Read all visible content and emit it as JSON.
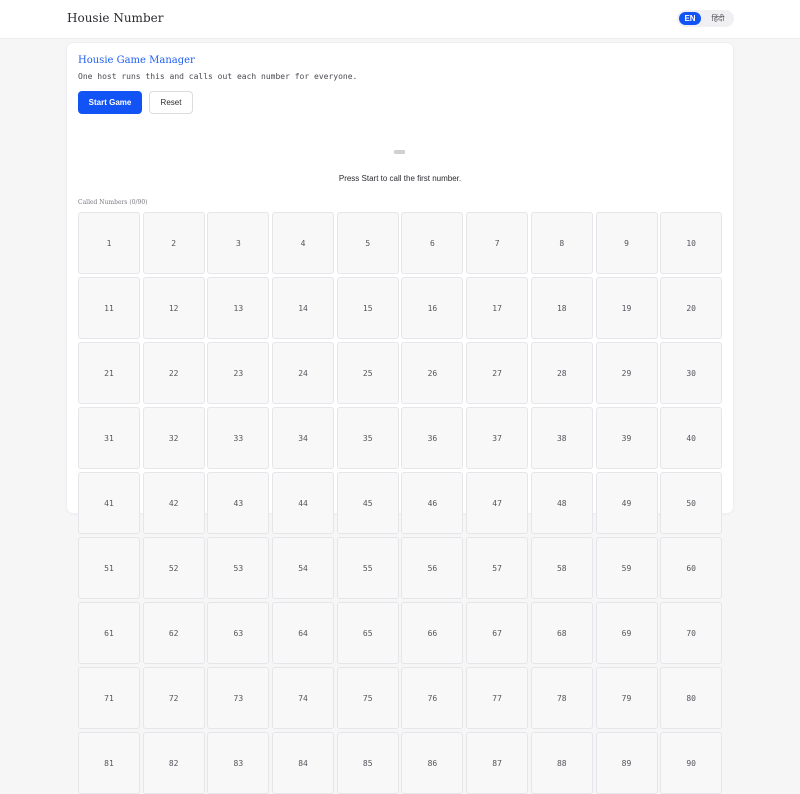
{
  "header": {
    "brand": "Housie Number",
    "languages": [
      "EN",
      "हिंदी"
    ],
    "active_language": "EN"
  },
  "manager": {
    "title": "Housie Game Manager",
    "description": "One host runs this and calls out each number for everyone.",
    "start_label": "Start Game",
    "reset_label": "Reset",
    "status": "Press Start to call the first number.",
    "called_label": "Called Numbers (0/90)"
  },
  "board": {
    "numbers": [
      1,
      2,
      3,
      4,
      5,
      6,
      7,
      8,
      9,
      10,
      11,
      12,
      13,
      14,
      15,
      16,
      17,
      18,
      19,
      20,
      21,
      22,
      23,
      24,
      25,
      26,
      27,
      28,
      29,
      30,
      31,
      32,
      33,
      34,
      35,
      36,
      37,
      38,
      39,
      40,
      41,
      42,
      43,
      44,
      45,
      46,
      47,
      48,
      49,
      50,
      51,
      52,
      53,
      54,
      55,
      56,
      57,
      58,
      59,
      60,
      61,
      62,
      63,
      64,
      65,
      66,
      67,
      68,
      69,
      70,
      71,
      72,
      73,
      74,
      75,
      76,
      77,
      78,
      79,
      80,
      81,
      82,
      83,
      84,
      85,
      86,
      87,
      88,
      89,
      90
    ]
  },
  "colors": {
    "accent": "#1253f5",
    "title": "#1f5ff0",
    "cell_bg": "#f8f8f9"
  }
}
